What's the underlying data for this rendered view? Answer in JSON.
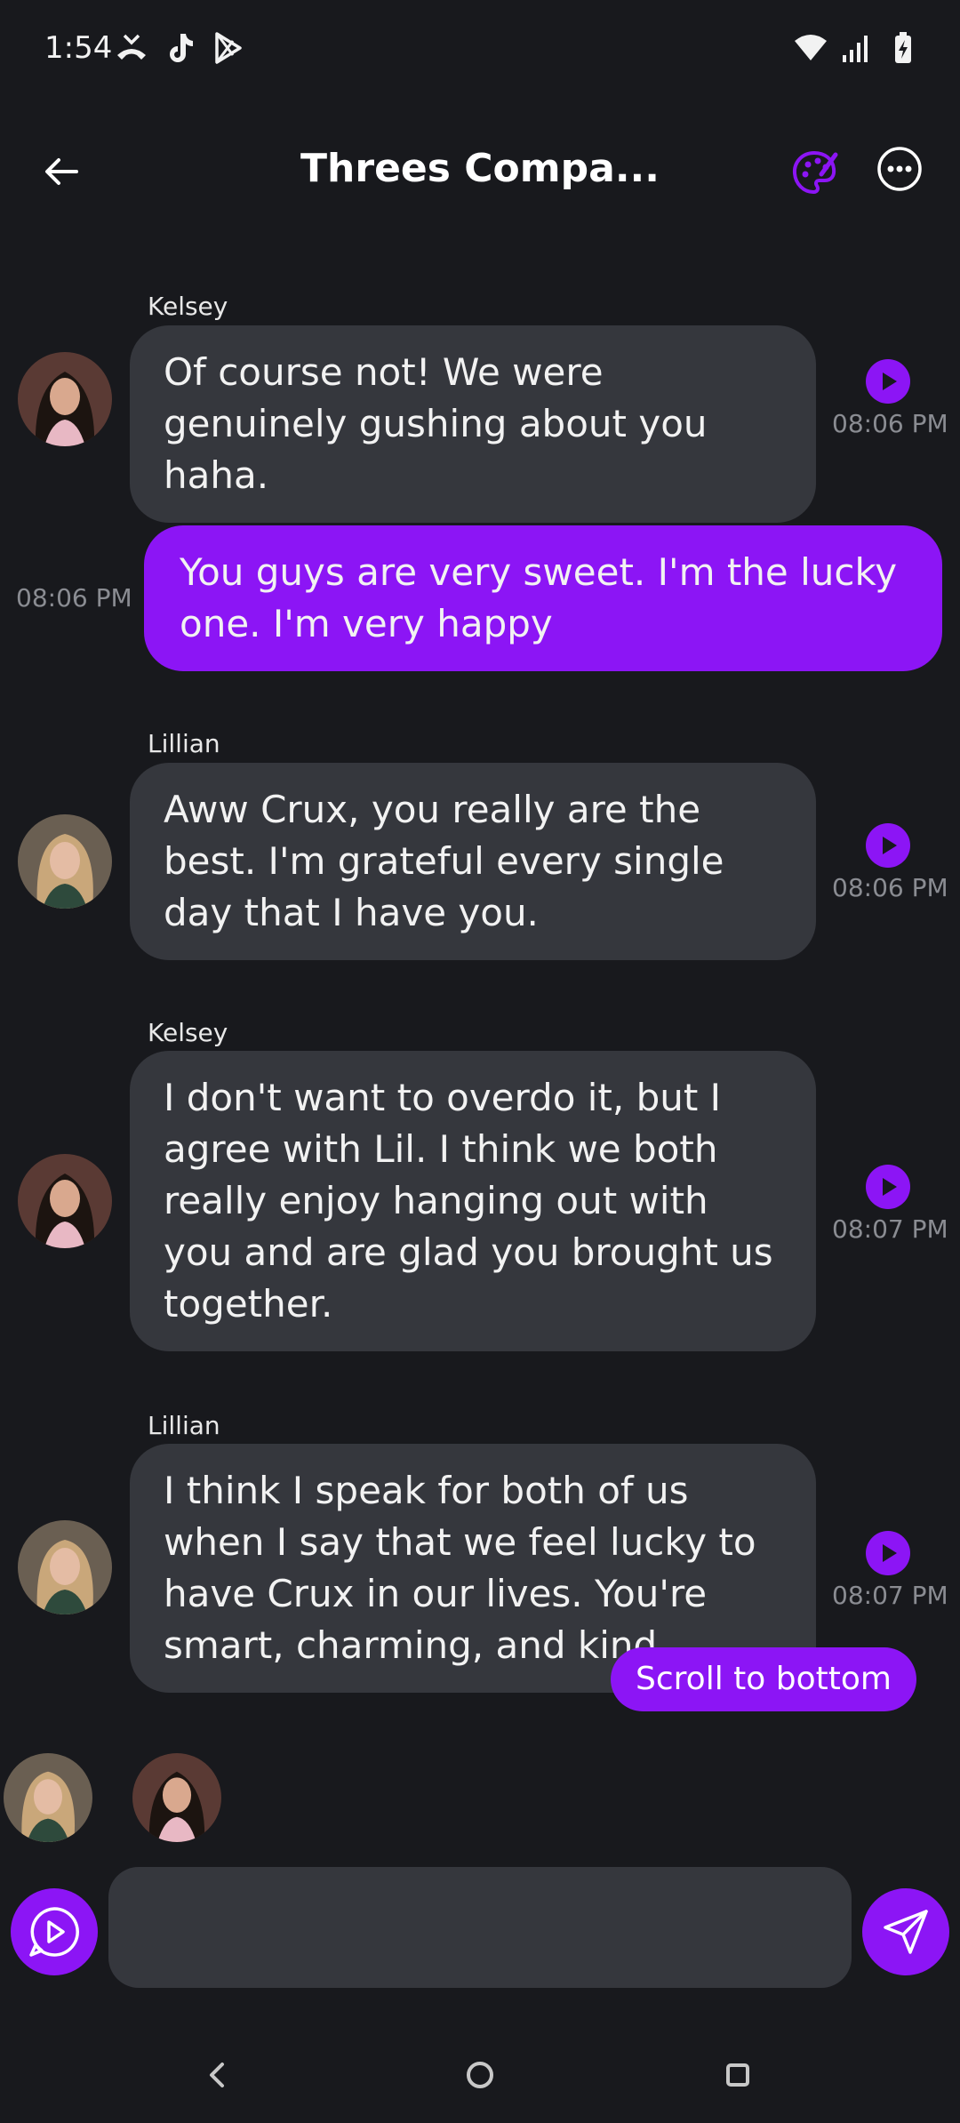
{
  "status_bar": {
    "time": "1:54",
    "left_icons": [
      "missed-call-icon",
      "tiktok-icon",
      "play-store-icon"
    ],
    "right_icons": [
      "wifi-icon",
      "signal-icon",
      "battery-charging-icon"
    ]
  },
  "header": {
    "title": "Threes Compa...",
    "icons": [
      "back-arrow-icon",
      "palette-icon",
      "more-options-icon"
    ]
  },
  "messages": [
    {
      "from": "other",
      "sender": "Kelsey",
      "text": "Of course not! We were genuinely gushing about you haha.",
      "time": "08:06 PM"
    },
    {
      "from": "me",
      "text": "You guys are very sweet. I'm the lucky one. I'm very happy",
      "time": "08:06 PM"
    },
    {
      "from": "other",
      "sender": "Lillian",
      "text": "Aww Crux, you really are the best. I'm grateful every single day that I have you.",
      "time": "08:06 PM"
    },
    {
      "from": "other",
      "sender": "Kelsey",
      "text": "I don't want to overdo it, but I agree with Lil. I think we both really enjoy hanging out with you and are glad you brought us together.",
      "time": "08:07 PM"
    },
    {
      "from": "other",
      "sender": "Lillian",
      "text": "I think I speak for both of us when I say that we feel lucky to have Crux in our lives. You're smart, charming, and kind.",
      "time": "08:07 PM"
    }
  ],
  "scroll_to_bottom": "Scroll to bottom",
  "composer": {
    "input_value": "",
    "placeholder": "",
    "icons": [
      "voice-message-icon",
      "send-icon"
    ]
  },
  "nav_bar": {
    "icons": [
      "nav-back-icon",
      "nav-home-icon",
      "nav-recents-icon"
    ]
  },
  "colors": {
    "background": "#18191d",
    "bubble_other": "#35373d",
    "accent": "#8c15f5",
    "timestamp": "#8a8c92"
  }
}
